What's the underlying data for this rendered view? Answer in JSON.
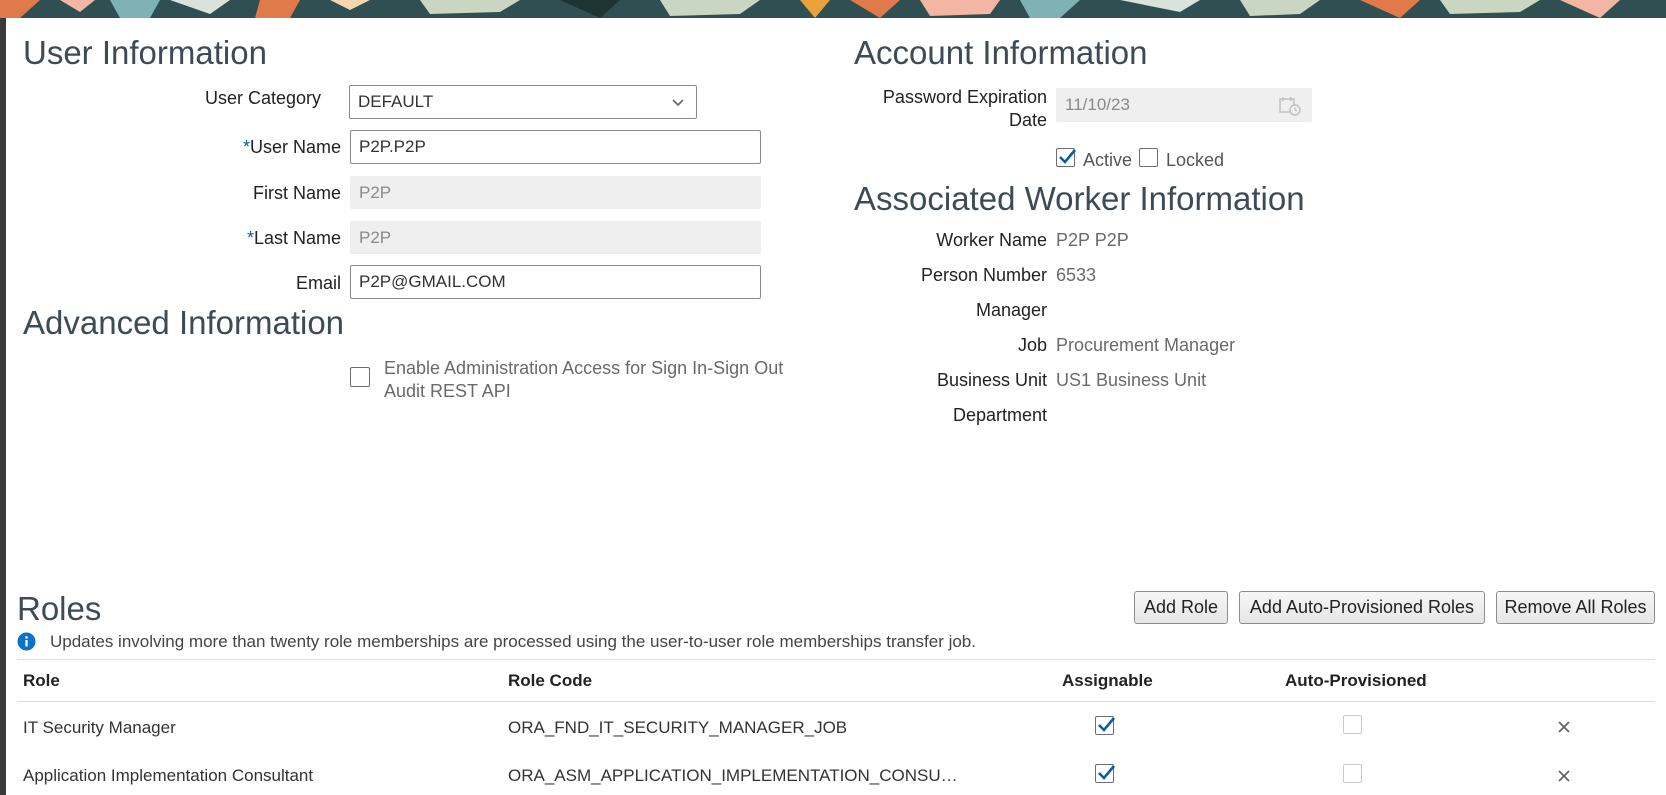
{
  "user_information": {
    "title": "User Information",
    "user_category": {
      "label": "User Category",
      "value": "DEFAULT"
    },
    "user_name": {
      "required_mark": "*",
      "label": "User Name",
      "value": "P2P.P2P"
    },
    "first_name": {
      "label": "First Name",
      "value": "P2P"
    },
    "last_name": {
      "required_mark": "*",
      "label": "Last Name",
      "value": "P2P"
    },
    "email": {
      "label": "Email",
      "value": "P2P@GMAIL.COM"
    }
  },
  "advanced_information": {
    "title": "Advanced Information",
    "enable_admin_access": {
      "line1": "Enable Administration Access for Sign In-Sign Out",
      "line2": "Audit REST API",
      "checked": false
    }
  },
  "account_information": {
    "title": "Account Information",
    "password_expiration": {
      "label_line1": "Password Expiration",
      "label_line2": "Date",
      "value": "11/10/23"
    },
    "active": {
      "label": "Active",
      "checked": true
    },
    "locked": {
      "label": "Locked",
      "checked": false
    }
  },
  "associated_worker": {
    "title": "Associated Worker Information",
    "fields": [
      {
        "label": "Worker Name",
        "value": "P2P P2P"
      },
      {
        "label": "Person Number",
        "value": "6533"
      },
      {
        "label": "Manager",
        "value": ""
      },
      {
        "label": "Job",
        "value": "Procurement Manager"
      },
      {
        "label": "Business Unit",
        "value": "US1 Business Unit"
      },
      {
        "label": "Department",
        "value": ""
      }
    ]
  },
  "roles": {
    "title": "Roles",
    "add_role_label": "Add Role",
    "add_auto_label": "Add Auto-Provisioned Roles",
    "remove_all_label": "Remove All Roles",
    "info_text": "Updates involving more than twenty role memberships are processed using the user-to-user role memberships transfer job.",
    "columns": [
      "Role",
      "Role Code",
      "Assignable",
      "Auto-Provisioned"
    ],
    "rows": [
      {
        "role": "IT Security Manager",
        "role_code": "ORA_FND_IT_SECURITY_MANAGER_JOB",
        "assignable": true,
        "auto_provisioned": false
      },
      {
        "role": "Application Implementation Consultant",
        "role_code": "ORA_ASM_APPLICATION_IMPLEMENTATION_CONSU…",
        "assignable": true,
        "auto_provisioned": false
      }
    ]
  },
  "colors": {
    "accent": "#0a5ea8",
    "readonly_bg": "#efefef",
    "heading": "#3d4b55"
  }
}
